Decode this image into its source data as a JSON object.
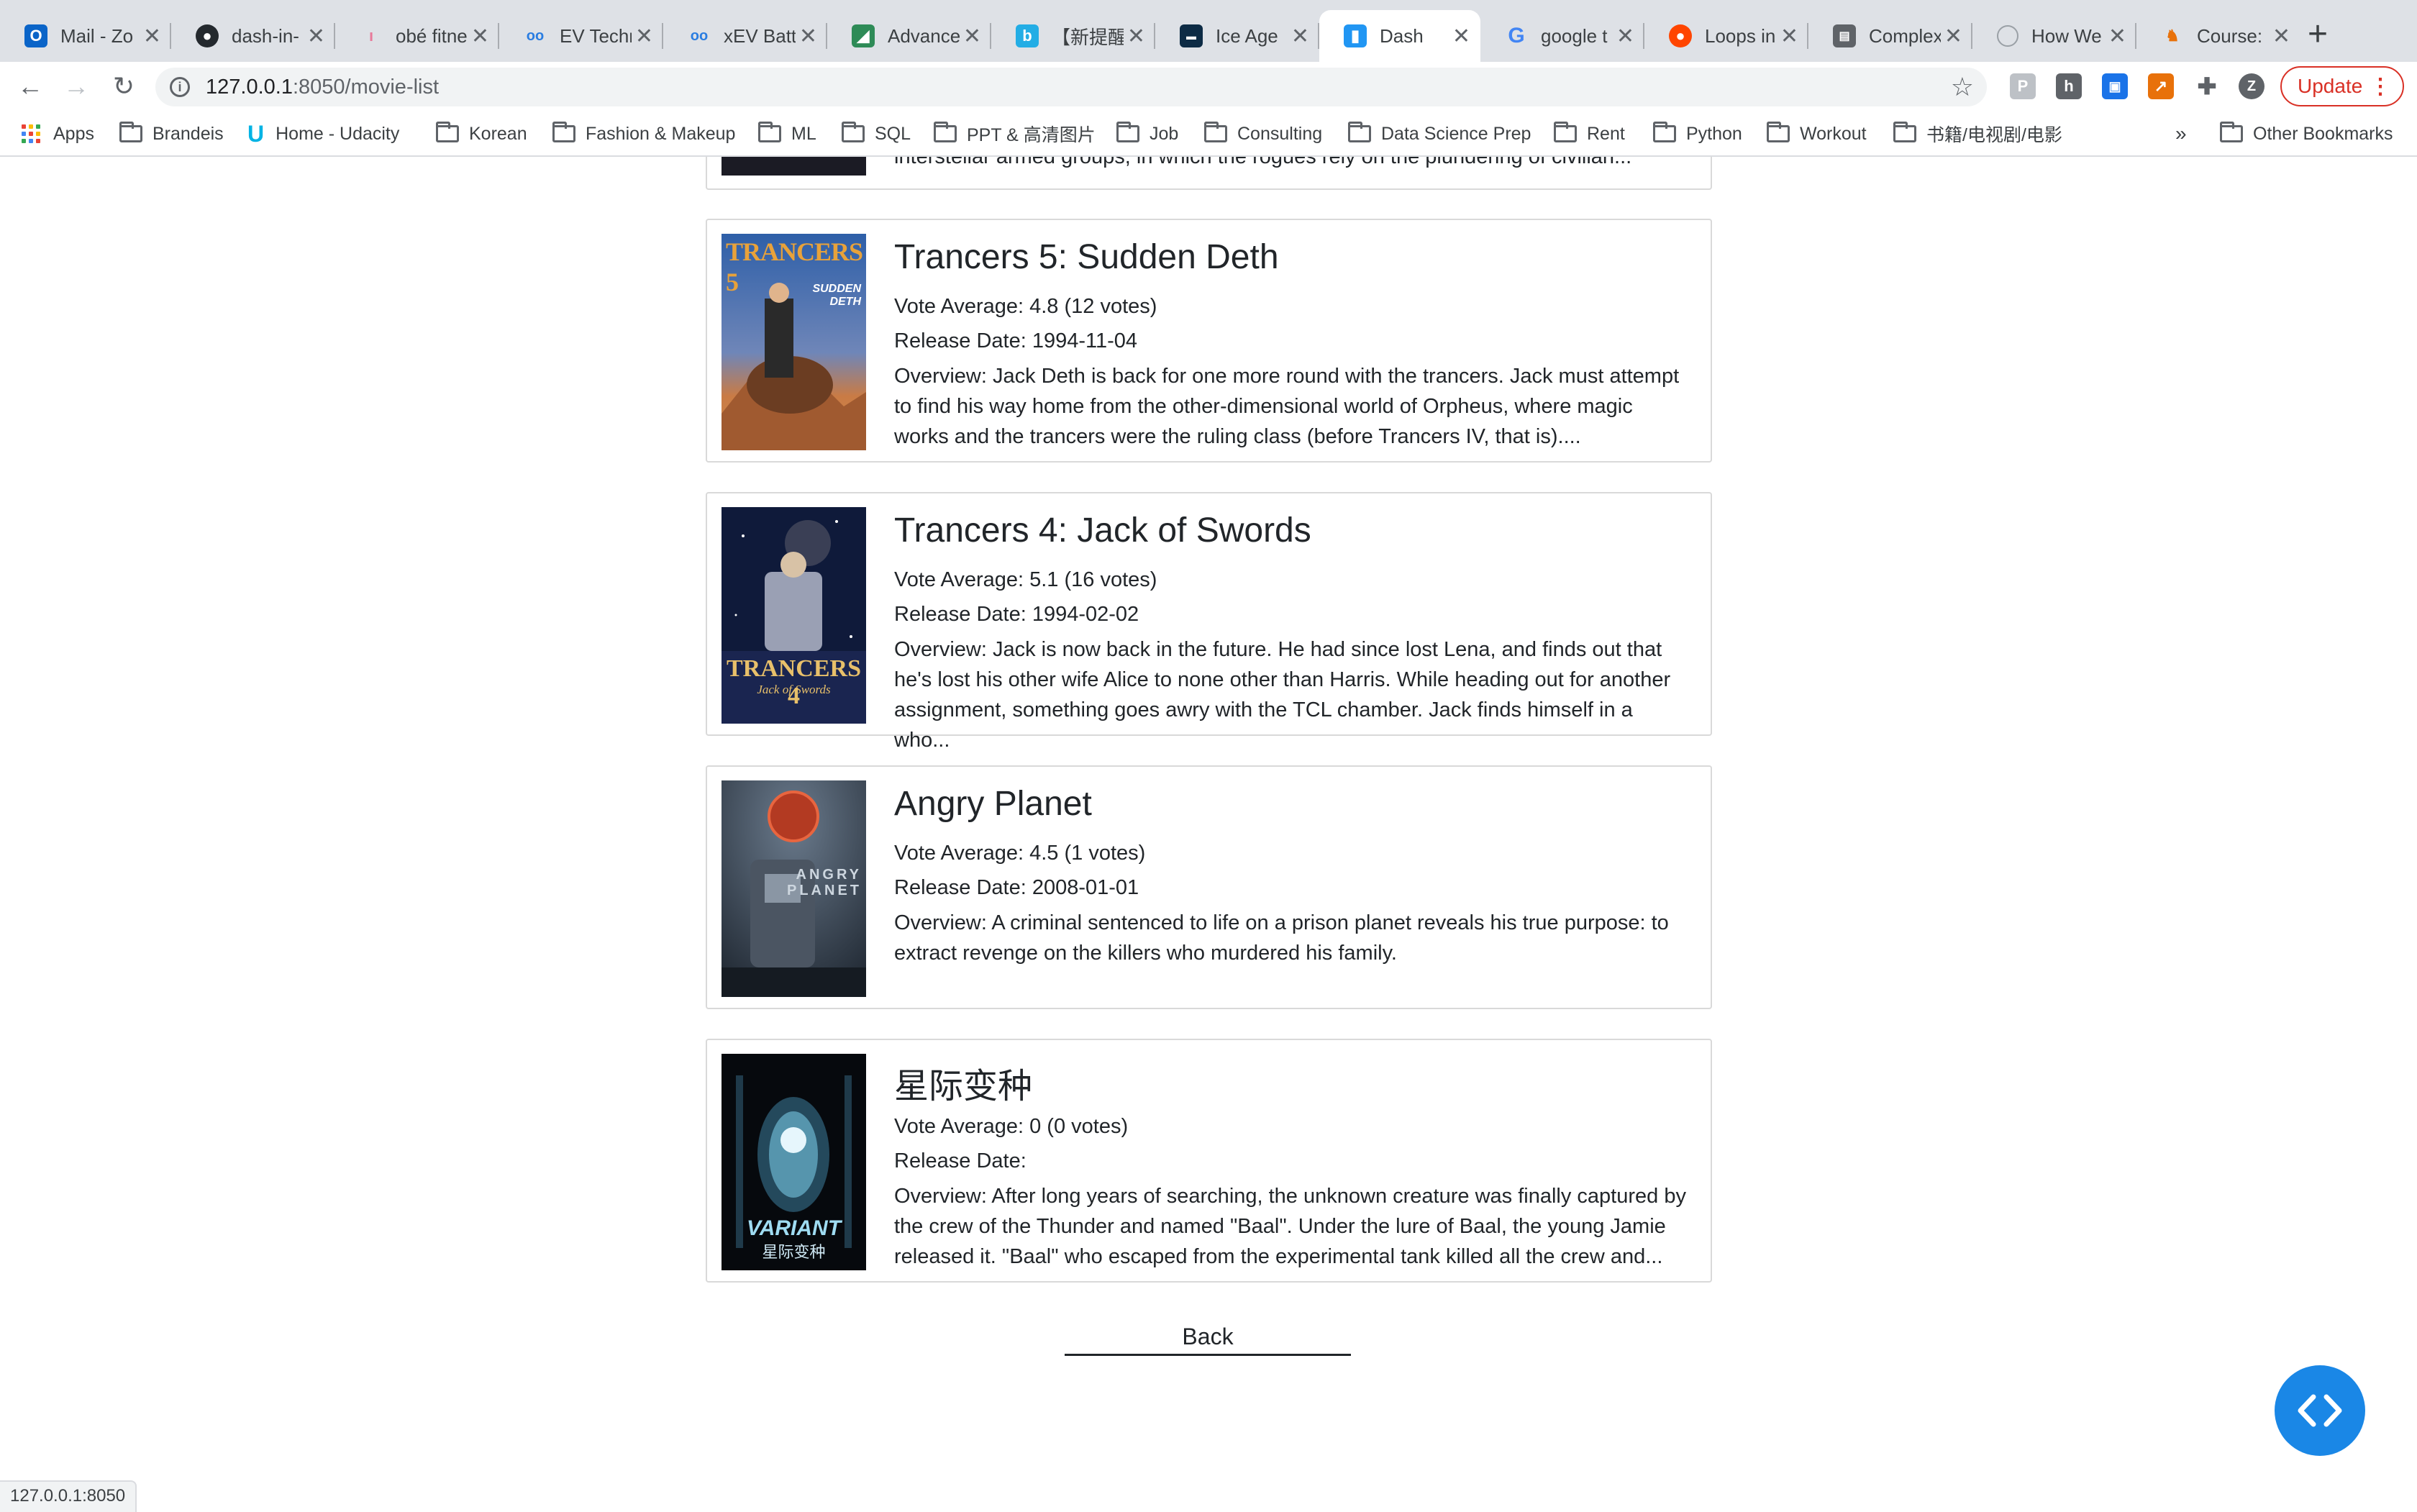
{
  "tabs": [
    {
      "title": "Mail - Zo",
      "icon": "outlook-icon",
      "color": "#0a64c8"
    },
    {
      "title": "dash-in-",
      "icon": "github-icon",
      "color": "#24292e"
    },
    {
      "title": "obé fitne",
      "icon": "obe-icon",
      "color": "#f4a7b9"
    },
    {
      "title": "EV Techn",
      "icon": "oo-icon",
      "color": "#2a7de1"
    },
    {
      "title": "xEV Batt",
      "icon": "oo-icon",
      "color": "#2a7de1"
    },
    {
      "title": "Advance",
      "icon": "advance-icon",
      "color": "#2e8b57"
    },
    {
      "title": "【新提醒",
      "icon": "bilibili-icon",
      "color": "#23ade5"
    },
    {
      "title": "Ice Age",
      "icon": "ice-age-icon",
      "color": "#0d2b45"
    },
    {
      "title": "Dash",
      "icon": "dash-icon",
      "color": "#2196f3",
      "active": true
    },
    {
      "title": "google t",
      "icon": "google-icon",
      "color": "#4285f4"
    },
    {
      "title": "Loops in",
      "icon": "reddit-icon",
      "color": "#ff4500"
    },
    {
      "title": "Complex",
      "icon": "complex-icon",
      "color": "#5f6368"
    },
    {
      "title": "How We",
      "icon": "how-we-icon",
      "color": "#9aa0a6"
    },
    {
      "title": "Course:",
      "icon": "course-icon",
      "color": "#e8710a"
    }
  ],
  "address_bar": {
    "host": "127.0.0.1",
    "path": ":8050/movie-list"
  },
  "update_label": "Update",
  "profile_initial": "Z",
  "bookmarks": [
    {
      "label": "Apps",
      "icon": "apps-grid-icon"
    },
    {
      "label": "Brandeis",
      "icon": "folder-icon"
    },
    {
      "label": "Home - Udacity",
      "icon": "udacity-icon"
    },
    {
      "label": "Korean",
      "icon": "folder-icon"
    },
    {
      "label": "Fashion & Makeup",
      "icon": "folder-icon"
    },
    {
      "label": "ML",
      "icon": "folder-icon"
    },
    {
      "label": "SQL",
      "icon": "folder-icon"
    },
    {
      "label": "PPT & 高清图片",
      "icon": "folder-icon"
    },
    {
      "label": "Job",
      "icon": "folder-icon"
    },
    {
      "label": "Consulting",
      "icon": "folder-icon"
    },
    {
      "label": "Data Science Prep",
      "icon": "folder-icon"
    },
    {
      "label": "Rent",
      "icon": "folder-icon"
    },
    {
      "label": "Python",
      "icon": "folder-icon"
    },
    {
      "label": "Workout",
      "icon": "folder-icon"
    },
    {
      "label": "书籍/电视剧/电影",
      "icon": "folder-icon"
    }
  ],
  "bookmarks_overflow": "»",
  "other_bookmarks": "Other Bookmarks",
  "partial_card_text": "interstellar armed groups, in which the rogues rely on the plundering of civilian...",
  "movies": [
    {
      "title": "Trancers 5: Sudden Deth",
      "vote": "Vote Average: 4.8 (12 votes)",
      "release": "Release Date: 1994-11-04",
      "overview": "Overview: Jack Deth is back for one more round with the trancers. Jack must attempt to find his way home from the other-dimensional world of Orpheus, where magic works and the trancers were the ruling class (before Trancers IV, that is)....",
      "poster_text": "TRANCERS 5",
      "poster_sub": "SUDDEN DETH"
    },
    {
      "title": "Trancers 4: Jack of Swords",
      "vote": "Vote Average: 5.1 (16 votes)",
      "release": "Release Date: 1994-02-02",
      "overview": "Overview: Jack is now back in the future. He had since lost Lena, and finds out that he's lost his other wife Alice to none other than Harris. While heading out for another assignment, something goes awry with the TCL chamber. Jack finds himself in a who...",
      "poster_text": "TRANCERS 4",
      "poster_sub": "Jack of Swords"
    },
    {
      "title": "Angry Planet",
      "vote": "Vote Average: 4.5 (1 votes)",
      "release": "Release Date: 2008-01-01",
      "overview": "Overview: A criminal sentenced to life on a prison planet reveals his true purpose: to extract revenge on the killers who murdered his family.",
      "poster_text": "ANGRY PLANET",
      "poster_sub": ""
    },
    {
      "title": "星际变种",
      "vote": "Vote Average: 0 (0 votes)",
      "release": "Release Date:",
      "overview": "Overview: After long years of searching, the unknown creature was finally captured by the crew of the Thunder and named \"Baal\". Under the lure of Baal, the young Jamie released it. \"Baal\" who escaped from the experimental tank killed all the crew and...",
      "poster_text": "VARIANT",
      "poster_sub": "星际变种"
    }
  ],
  "back_label": "Back",
  "status_url": "127.0.0.1:8050"
}
